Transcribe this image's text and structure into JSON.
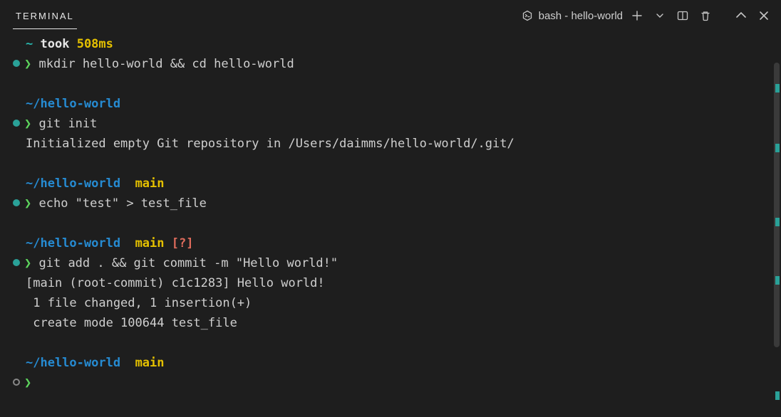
{
  "titlebar": {
    "tab_label": "TERMINAL",
    "shell_label": "bash - hello-world"
  },
  "term": {
    "tilde": "~",
    "took": "took",
    "timing": "508ms",
    "arrow": "❯",
    "cmd1": "mkdir hello-world && cd hello-world",
    "path_hw": "~/hello-world",
    "cmd2": "git init",
    "out2": "Initialized empty Git repository in /Users/daimms/hello-world/.git/",
    "branch_glyph": "",
    "branch": "main",
    "cmd3": "echo \"test\" > test_file",
    "status_unknown": "[?]",
    "cmd4": "git add . && git commit -m \"Hello world!\"",
    "out4a": "[main (root-commit) c1c1283] Hello world!",
    "out4b": " 1 file changed, 1 insertion(+)",
    "out4c": " create mode 100644 test_file"
  }
}
